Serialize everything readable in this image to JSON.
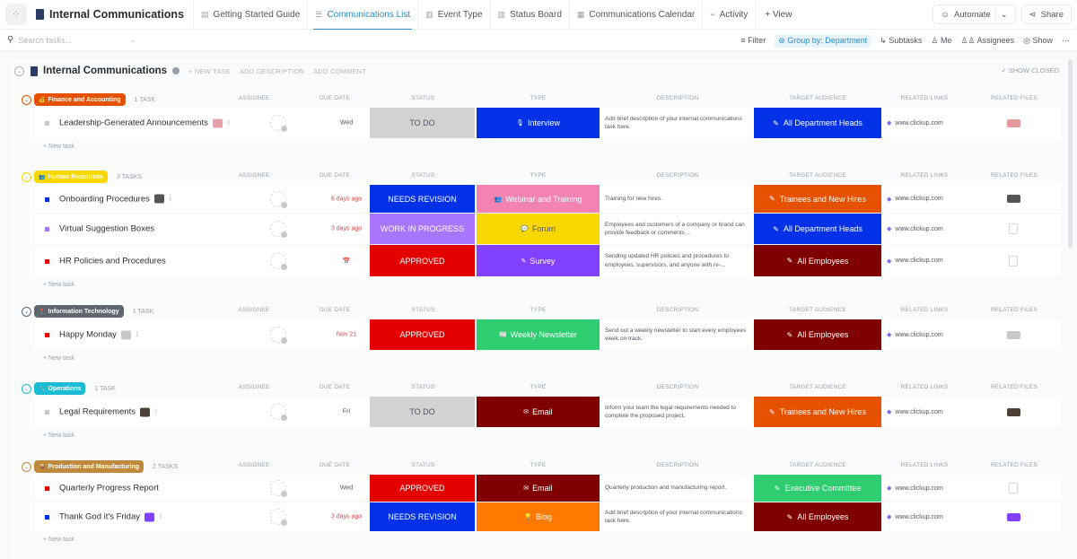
{
  "app": {
    "title": "Internal Communications",
    "tabs": [
      {
        "label": "Getting Started Guide",
        "icon": "doc-icon",
        "active": false
      },
      {
        "label": "Communications List",
        "icon": "list-icon",
        "active": true
      },
      {
        "label": "Event Type",
        "icon": "board-icon",
        "active": false
      },
      {
        "label": "Status Board",
        "icon": "board-icon",
        "active": false
      },
      {
        "label": "Communications Calendar",
        "icon": "calendar-icon",
        "active": false
      },
      {
        "label": "Activity",
        "icon": "activity-icon",
        "active": false
      }
    ],
    "add_view": "+ View",
    "automate": "Automate",
    "share": "Share"
  },
  "toolbar": {
    "search_placeholder": "Search tasks...",
    "filter": "Filter",
    "group_by": "Group by: Department",
    "subtasks": "Subtasks",
    "me": "Me",
    "assignees": "Assignees",
    "show": "Show",
    "more": "···"
  },
  "list": {
    "title": "Internal Communications",
    "new_task": "+ NEW TASK",
    "add_description": "ADD DESCRIPTION",
    "add_comment": "ADD COMMENT",
    "show_closed": "✓ SHOW CLOSED",
    "new_task_row": "+ New task"
  },
  "columns": {
    "assignee": "ASSIGNEE",
    "due_date": "DUE DATE",
    "status": "STATUS",
    "type": "TYPE",
    "description": "DESCRIPTION",
    "target_audience": "TARGET AUDIENCE",
    "related_links": "RELATED LINKS",
    "related_files": "RELATED FILES"
  },
  "colors": {
    "todo": "#d3d3d3",
    "needs_revision": "#0231e8",
    "work_in_progress": "#a875ff",
    "approved": "#e50000",
    "interview": "#0231e8",
    "webinar": "#f383b2",
    "forum": "#f8d800",
    "survey": "#8141ff",
    "newsletter": "#2ecd6f",
    "email": "#800000",
    "blog": "#ff7800",
    "aud_heads": "#0231e8",
    "aud_trainees": "#e65100",
    "aud_employees": "#800000",
    "aud_exec": "#2ecd6f"
  },
  "groups": [
    {
      "name": "Finance and Accounting",
      "count": "1 TASK",
      "color": "#e65100",
      "emoji": "💰",
      "tasks": [
        {
          "name": "Leadership-Generated Announcements",
          "dot": "#c4c7cc",
          "thumb": "#e5a3a8",
          "clip": true,
          "due": "Wed",
          "late": false,
          "status": "TO DO",
          "status_bg": "#d3d3d3",
          "status_fg": "#4f5660",
          "type": "Interview",
          "type_icon": "🎙",
          "type_bg": "#0231e8",
          "type_fg": "#ffffff",
          "desc": "Add brief description of your internal communications task here.",
          "aud": "All Department Heads",
          "aud_icon": "✎",
          "aud_bg": "#0231e8",
          "link": "www.clickup.com",
          "file": "thumb",
          "file_color": "#e59aa0"
        }
      ]
    },
    {
      "name": "Human Resources",
      "count": "3 TASKS",
      "color": "#f8d800",
      "emoji": "👥",
      "tasks": [
        {
          "name": "Onboarding Procedures",
          "dot": "#0231e8",
          "thumb": "#555",
          "clip": true,
          "due": "6 days ago",
          "late": true,
          "status": "NEEDS REVISION",
          "status_bg": "#0231e8",
          "status_fg": "#ffffff",
          "type": "Webinar and Training",
          "type_icon": "👥",
          "type_bg": "#f383b2",
          "type_fg": "#ffffff",
          "desc": "Training for new hires.",
          "aud": "Trainees and New Hires",
          "aud_icon": "✎",
          "aud_bg": "#e65100",
          "link": "www.clickup.com",
          "file": "thumb",
          "file_color": "#555"
        },
        {
          "name": "Virtual Suggestion Boxes",
          "dot": "#a875ff",
          "thumb": "",
          "clip": false,
          "due": "3 days ago",
          "late": true,
          "status": "WORK IN PROGRESS",
          "status_bg": "#a875ff",
          "status_fg": "#ffffff",
          "type": "Forum",
          "type_icon": "💬",
          "type_bg": "#f8d800",
          "type_fg": "#4f5660",
          "desc": "Employees and customers of a company or brand can provide feedback or comments ...",
          "aud": "All Department Heads",
          "aud_icon": "✎",
          "aud_bg": "#0231e8",
          "link": "www.clickup.com",
          "file": "doc",
          "file_color": ""
        },
        {
          "name": "HR Policies and Procedures",
          "dot": "#e50000",
          "thumb": "",
          "clip": false,
          "due": "📅",
          "late": false,
          "status": "APPROVED",
          "status_bg": "#e50000",
          "status_fg": "#ffffff",
          "type": "Survey",
          "type_icon": "✎",
          "type_bg": "#8141ff",
          "type_fg": "#ffffff",
          "desc": "Sending updated HR policies and procedures to employees, supervisors, and anyone with re-...",
          "aud": "All Employees",
          "aud_icon": "✎",
          "aud_bg": "#800000",
          "link": "www.clickup.com",
          "file": "doc",
          "file_color": ""
        }
      ]
    },
    {
      "name": "Information Technology",
      "count": "1 TASK",
      "color": "#5f6670",
      "emoji": "📍",
      "tasks": [
        {
          "name": "Happy Monday",
          "dot": "#e50000",
          "thumb": "#c8c8c8",
          "clip": true,
          "due": "Nov 21",
          "late": true,
          "status": "APPROVED",
          "status_bg": "#e50000",
          "status_fg": "#ffffff",
          "type": "Weekly Newsletter",
          "type_icon": "📰",
          "type_bg": "#2ecd6f",
          "type_fg": "#ffffff",
          "desc": "Send out a weekly newsletter to start every employees week on track.",
          "aud": "All Employees",
          "aud_icon": "✎",
          "aud_bg": "#800000",
          "link": "www.clickup.com",
          "file": "thumb",
          "file_color": "#c8c8c8"
        }
      ]
    },
    {
      "name": "Operations",
      "count": "1 TASK",
      "color": "#1bbcd3",
      "emoji": "🔧",
      "tasks": [
        {
          "name": "Legal Requirements",
          "dot": "#c4c7cc",
          "thumb": "#4a4036",
          "clip": true,
          "due": "Fri",
          "late": false,
          "status": "TO DO",
          "status_bg": "#d3d3d3",
          "status_fg": "#4f5660",
          "type": "Email",
          "type_icon": "✉",
          "type_bg": "#800000",
          "type_fg": "#ffffff",
          "desc": "Inform your team the legal requirements needed to complete the proposed project.",
          "aud": "Trainees and New Hires",
          "aud_icon": "✎",
          "aud_bg": "#e65100",
          "link": "www.clickup.com",
          "file": "thumb",
          "file_color": "#4a4036"
        }
      ]
    },
    {
      "name": "Production and Manufacturing",
      "count": "2 TASKS",
      "color": "#c08a3e",
      "emoji": "📦",
      "tasks": [
        {
          "name": "Quarterly Progress Report",
          "dot": "#e50000",
          "thumb": "",
          "clip": false,
          "due": "Wed",
          "late": false,
          "status": "APPROVED",
          "status_bg": "#e50000",
          "status_fg": "#ffffff",
          "type": "Email",
          "type_icon": "✉",
          "type_bg": "#800000",
          "type_fg": "#ffffff",
          "desc": "Quarterly production and manufacturing report.",
          "aud": "Executive Committee",
          "aud_icon": "✎",
          "aud_bg": "#2ecd6f",
          "link": "www.clickup.com",
          "file": "doc",
          "file_color": ""
        },
        {
          "name": "Thank God it's Friday",
          "dot": "#0231e8",
          "thumb": "#8141ff",
          "clip": true,
          "due": "3 days ago",
          "late": true,
          "status": "NEEDS REVISION",
          "status_bg": "#0231e8",
          "status_fg": "#ffffff",
          "type": "Blog",
          "type_icon": "💡",
          "type_bg": "#ff7800",
          "type_fg": "#ffffff",
          "desc": "Add brief description of your internal communications task here.",
          "aud": "All Employees",
          "aud_icon": "✎",
          "aud_bg": "#800000",
          "link": "www.clickup.com",
          "file": "thumb",
          "file_color": "#8141ff"
        }
      ]
    }
  ]
}
